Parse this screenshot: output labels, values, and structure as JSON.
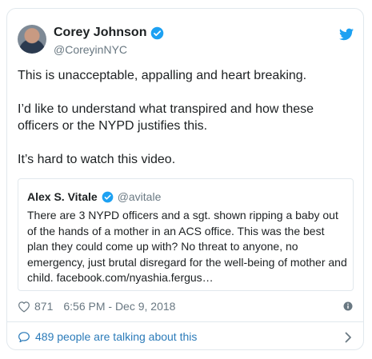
{
  "tweet": {
    "author_name": "Corey Johnson",
    "author_handle": "@CoreyinNYC",
    "body": [
      "This is unacceptable, appalling and heart breaking.",
      "I’d like to understand what transpired and how these officers or the NYPD justifies this.",
      "It’s hard to watch this video."
    ],
    "likes": "871",
    "timestamp": "6:56 PM - Dec 9, 2018",
    "talking": "489 people are talking about this"
  },
  "quoted": {
    "author_name": "Alex S. Vitale",
    "author_handle": "@avitale",
    "text": "There are 3 NYPD officers and a sgt. shown ripping a baby out of the hands of a mother in an ACS office. This was the best plan they could come up with? No threat to anyone, no emergency, just brutal disregard for the well-being of mother and child. facebook.com/nyashia.fergus…"
  },
  "icons": {
    "avatar": "avatar",
    "verified": "verified-badge-icon",
    "brand": "twitter-bird-icon",
    "like": "heart-icon",
    "info": "info-icon",
    "comment": "speech-bubble-icon",
    "more": "chevron-right-icon"
  },
  "colors": {
    "twitter_blue": "#1da1f2",
    "link_blue": "#2b7bb9",
    "muted_text": "#697882",
    "border": "#e1e8ed"
  }
}
